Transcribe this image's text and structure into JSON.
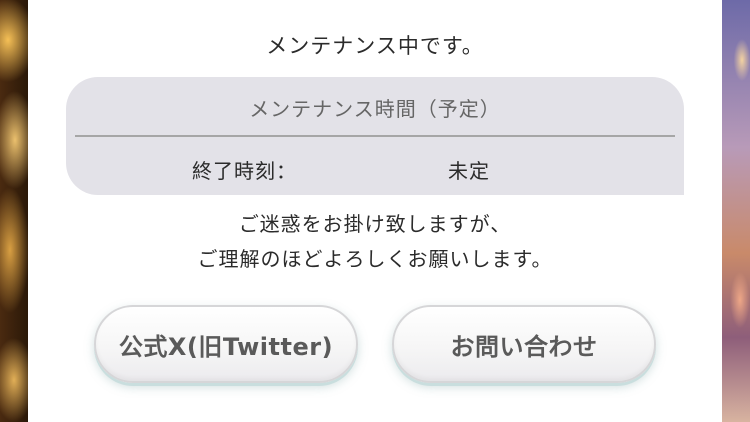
{
  "dialog": {
    "title": "メンテナンス中です。",
    "schedule": {
      "header": "メンテナンス時間（予定）",
      "end_label": "終了時刻：",
      "end_value": "未定"
    },
    "message_lines": [
      "ご迷惑をお掛け致しますが、",
      "ご理解のほどよろしくお願いします。"
    ],
    "buttons": {
      "twitter_label": "公式X(旧Twitter)",
      "contact_label": "お問い合わせ"
    }
  },
  "colors": {
    "dialog_bg": "#ffffff",
    "info_box_bg": "#e3e2e8",
    "text_primary": "#2b2b2b",
    "text_secondary": "#666666",
    "button_text": "#5a5a5a"
  }
}
